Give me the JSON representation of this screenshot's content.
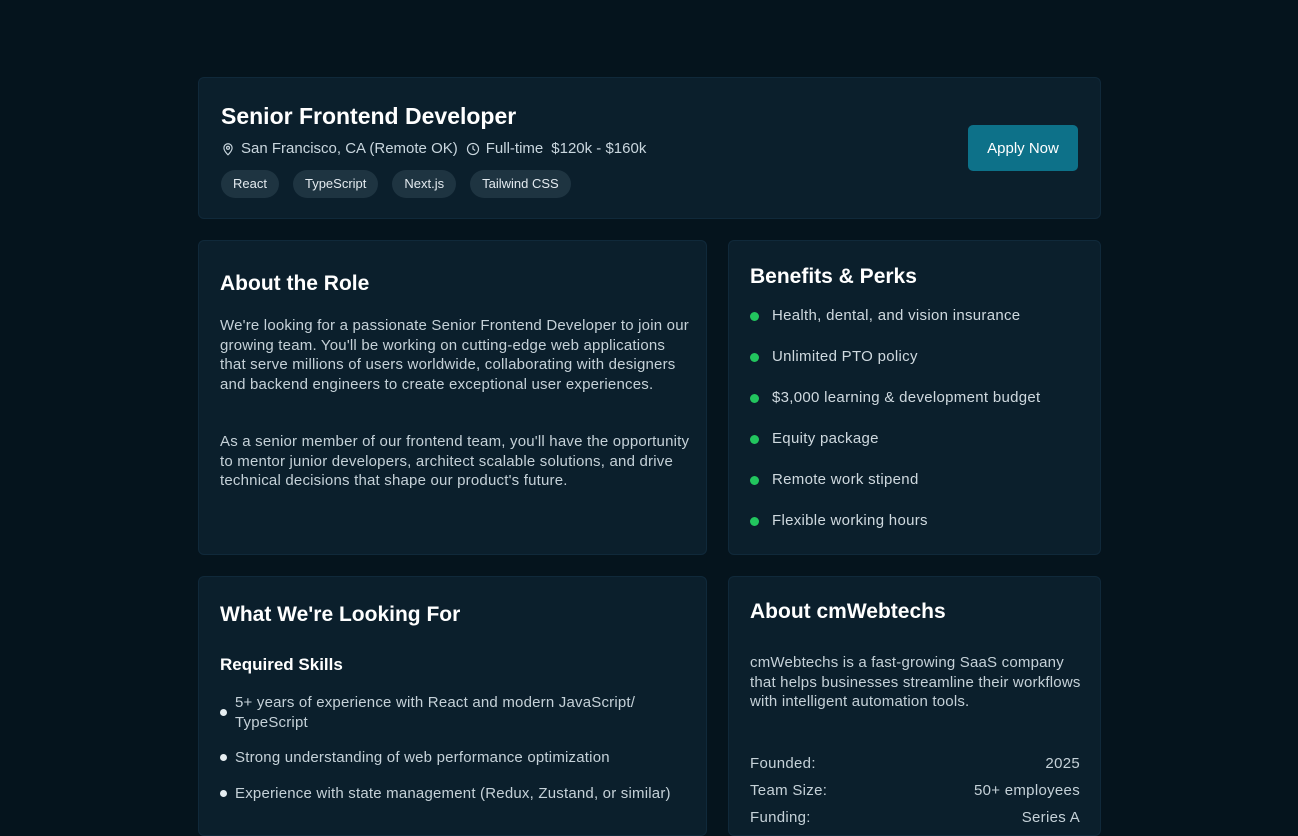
{
  "job": {
    "title": "Senior Frontend Developer",
    "location": "San Francisco, CA (Remote OK)",
    "type": "Full-time",
    "salary": "$120k - $160k",
    "tags": [
      "React",
      "TypeScript",
      "Next.js",
      "Tailwind CSS"
    ],
    "apply_label": "Apply Now"
  },
  "about_role": {
    "heading": "About the Role",
    "paragraphs": [
      "We're looking for a passionate Senior Frontend Developer to join our growing team. You'll be working on cutting-edge web applications that serve millions of users worldwide, collaborating with designers and backend engineers to create exceptional user experiences.",
      "As a senior member of our frontend team, you'll have the opportunity to mentor junior developers, architect scalable solutions, and drive technical decisions that shape our product's future."
    ]
  },
  "benefits": {
    "heading": "Benefits & Perks",
    "items": [
      "Health, dental, and vision insurance",
      "Unlimited PTO policy",
      "$3,000 learning & development budget",
      "Equity package",
      "Remote work stipend",
      "Flexible working hours"
    ]
  },
  "looking_for": {
    "heading": "What We're Looking For",
    "subheading": "Required Skills",
    "skills": [
      "5+ years of experience with React and modern JavaScript/ TypeScript",
      "Strong understanding of web performance optimization",
      "Experience with state management (Redux, Zustand, or similar)"
    ]
  },
  "company": {
    "heading": "About cmWebtechs",
    "description": "cmWebtechs is a fast-growing SaaS company that helps businesses streamline their workflows with intelligent automation tools.",
    "facts": [
      {
        "label": "Founded:",
        "value": "2025"
      },
      {
        "label": "Team Size:",
        "value": "50+ employees"
      },
      {
        "label": "Funding:",
        "value": "Series A"
      }
    ]
  },
  "colors": {
    "background": "#05141d",
    "card": "#0b1f2c",
    "accent_button": "#0d7189",
    "benefit_bullet": "#22c55e",
    "tag_bg": "#1e3441"
  },
  "icons": {
    "location": "map-pin-icon",
    "time": "clock-icon"
  }
}
